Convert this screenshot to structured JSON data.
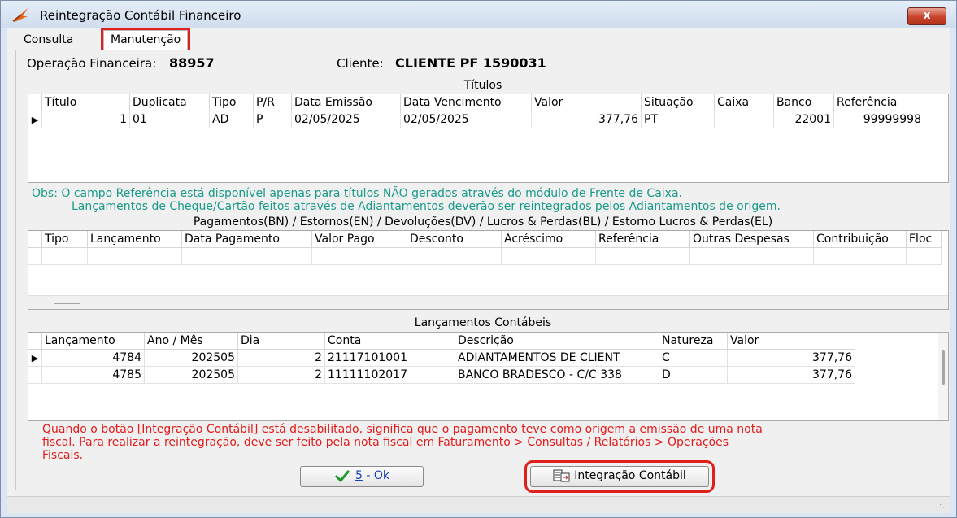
{
  "window": {
    "title": "Reintegração Contábil Financeiro",
    "close_label": "x"
  },
  "tabs": [
    {
      "label": "Consulta"
    },
    {
      "label": "Manutenção",
      "active": true
    }
  ],
  "header": {
    "op_label": "Operação Financeira:",
    "op_value": "88957",
    "client_label": "Cliente:",
    "client_value": "CLIENTE PF 1590031"
  },
  "titulos": {
    "label": "Títulos",
    "columns": [
      "Título",
      "Duplicata",
      "Tipo",
      "P/R",
      "Data Emissão",
      "Data Vencimento",
      "Valor",
      "Situação",
      "Caixa",
      "Banco",
      "Referência"
    ],
    "rows": [
      [
        "1",
        "01",
        "AD",
        "P",
        "02/05/2025",
        "02/05/2025",
        "377,76",
        "PT",
        "",
        "22001",
        "99999998"
      ]
    ]
  },
  "obs": {
    "line1": "Obs: O campo Referência está disponível apenas para títulos NÃO gerados através do módulo de Frente de Caixa.",
    "line2": "Lançamentos de Cheque/Cartão feitos através de Adiantamentos deverão ser reintegrados pelos Adiantamentos de origem."
  },
  "pagamentos": {
    "label": "Pagamentos(BN) / Estornos(EN) / Devoluções(DV) / Lucros & Perdas(BL)  / Estorno Lucros & Perdas(EL)",
    "columns": [
      "Tipo",
      "Lançamento",
      "Data Pagamento",
      "Valor Pago",
      "Desconto",
      "Acréscimo",
      "Referência",
      "Outras Despesas",
      "Contribuição",
      "Floc"
    ]
  },
  "lancamentos": {
    "label": "Lançamentos Contábeis",
    "columns": [
      "Lançamento",
      "Ano / Mês",
      "Dia",
      "Conta",
      "Descrição",
      "Natureza",
      "Valor"
    ],
    "rows": [
      [
        "4784",
        "202505",
        "2",
        "21117101001",
        "ADIANTAMENTOS DE CLIENT",
        "C",
        "377,76"
      ],
      [
        "4785",
        "202505",
        "2",
        "11111102017",
        "BANCO BRADESCO - C/C 338",
        "D",
        "377,76"
      ]
    ]
  },
  "warning": {
    "line1": "Quando o botão [Integração Contábil] está desabilitado, significa que o pagamento teve como origem a emissão de uma nota",
    "line2": "fiscal. Para realizar a reintegração, deve ser feito pela nota fiscal em Faturamento > Consultas / Relatórios > Operações",
    "line3": "Fiscais."
  },
  "buttons": {
    "ok_key": "5",
    "ok_rest": " - Ok",
    "integracao": "Integração Contábil"
  },
  "colors": {
    "teal": "#1a9a8a",
    "red": "#e21a1a",
    "highlight": "#e0201c"
  }
}
